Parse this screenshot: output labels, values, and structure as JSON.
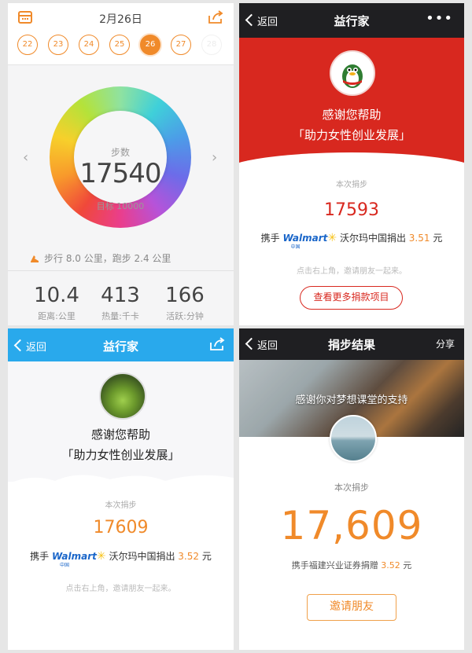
{
  "screen1": {
    "date": "2月26日",
    "days": [
      "22",
      "23",
      "24",
      "25",
      "26",
      "27",
      "28"
    ],
    "selected_day": "26",
    "ring": {
      "label": "步数",
      "value": "17540",
      "goal": "目标 10000"
    },
    "walk_summary": "步行 8.0 公里，跑步 2.4 公里",
    "stats": [
      {
        "value": "10.4",
        "label": "距离:公里"
      },
      {
        "value": "413",
        "label": "热量:千卡"
      },
      {
        "value": "166",
        "label": "活跃:分钟"
      }
    ]
  },
  "screen2": {
    "back": "返回",
    "title": "益行家",
    "more": "•••",
    "thanks_line1": "感谢您帮助",
    "thanks_line2": "「助力女性创业发展」",
    "amount_label": "本次捐步",
    "steps": "17593",
    "donate_prefix": "携手",
    "walmart": "Walmart",
    "walmart_sub": "中国",
    "donate_middle": "沃尔玛中国捐出",
    "money": "3.51",
    "unit": "元",
    "hint": "点击右上角，邀请朋友一起来。",
    "more_button": "查看更多捐款项目"
  },
  "screen3": {
    "back": "返回",
    "title": "益行家",
    "thanks_line1": "感谢您帮助",
    "thanks_line2": "「助力女性创业发展」",
    "amount_label": "本次捐步",
    "steps": "17609",
    "donate_prefix": "携手",
    "walmart": "Walmart",
    "walmart_sub": "中国",
    "donate_middle": "沃尔玛中国捐出",
    "money": "3.52",
    "unit": "元",
    "hint": "点击右上角，邀请朋友一起来。"
  },
  "screen4": {
    "back": "返回",
    "title": "捐步结果",
    "share": "分享",
    "photo_text": "感谢你对梦想课堂的支持",
    "amount_label": "本次捐步",
    "steps": "17,609",
    "donate_prefix": "携手福建兴业证券捐赠",
    "money": "3.52",
    "unit": "元",
    "invite_button": "邀请朋友"
  },
  "colors": {
    "orange": "#f08a2a",
    "red": "#d8281f",
    "blue": "#29a9ec",
    "dark": "#1f1f22",
    "walmart_blue": "#1a66c9"
  }
}
